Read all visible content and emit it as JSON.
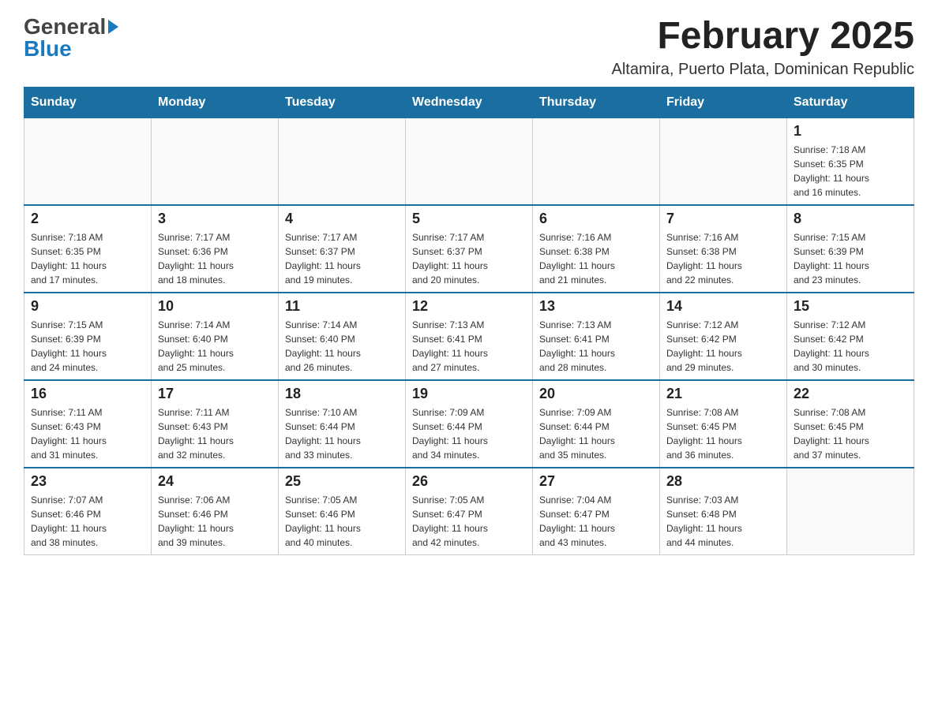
{
  "header": {
    "logo_general": "General",
    "logo_blue": "Blue",
    "month_title": "February 2025",
    "location": "Altamira, Puerto Plata, Dominican Republic"
  },
  "weekdays": [
    "Sunday",
    "Monday",
    "Tuesday",
    "Wednesday",
    "Thursday",
    "Friday",
    "Saturday"
  ],
  "weeks": [
    {
      "days": [
        {
          "number": "",
          "info": ""
        },
        {
          "number": "",
          "info": ""
        },
        {
          "number": "",
          "info": ""
        },
        {
          "number": "",
          "info": ""
        },
        {
          "number": "",
          "info": ""
        },
        {
          "number": "",
          "info": ""
        },
        {
          "number": "1",
          "info": "Sunrise: 7:18 AM\nSunset: 6:35 PM\nDaylight: 11 hours\nand 16 minutes."
        }
      ]
    },
    {
      "days": [
        {
          "number": "2",
          "info": "Sunrise: 7:18 AM\nSunset: 6:35 PM\nDaylight: 11 hours\nand 17 minutes."
        },
        {
          "number": "3",
          "info": "Sunrise: 7:17 AM\nSunset: 6:36 PM\nDaylight: 11 hours\nand 18 minutes."
        },
        {
          "number": "4",
          "info": "Sunrise: 7:17 AM\nSunset: 6:37 PM\nDaylight: 11 hours\nand 19 minutes."
        },
        {
          "number": "5",
          "info": "Sunrise: 7:17 AM\nSunset: 6:37 PM\nDaylight: 11 hours\nand 20 minutes."
        },
        {
          "number": "6",
          "info": "Sunrise: 7:16 AM\nSunset: 6:38 PM\nDaylight: 11 hours\nand 21 minutes."
        },
        {
          "number": "7",
          "info": "Sunrise: 7:16 AM\nSunset: 6:38 PM\nDaylight: 11 hours\nand 22 minutes."
        },
        {
          "number": "8",
          "info": "Sunrise: 7:15 AM\nSunset: 6:39 PM\nDaylight: 11 hours\nand 23 minutes."
        }
      ]
    },
    {
      "days": [
        {
          "number": "9",
          "info": "Sunrise: 7:15 AM\nSunset: 6:39 PM\nDaylight: 11 hours\nand 24 minutes."
        },
        {
          "number": "10",
          "info": "Sunrise: 7:14 AM\nSunset: 6:40 PM\nDaylight: 11 hours\nand 25 minutes."
        },
        {
          "number": "11",
          "info": "Sunrise: 7:14 AM\nSunset: 6:40 PM\nDaylight: 11 hours\nand 26 minutes."
        },
        {
          "number": "12",
          "info": "Sunrise: 7:13 AM\nSunset: 6:41 PM\nDaylight: 11 hours\nand 27 minutes."
        },
        {
          "number": "13",
          "info": "Sunrise: 7:13 AM\nSunset: 6:41 PM\nDaylight: 11 hours\nand 28 minutes."
        },
        {
          "number": "14",
          "info": "Sunrise: 7:12 AM\nSunset: 6:42 PM\nDaylight: 11 hours\nand 29 minutes."
        },
        {
          "number": "15",
          "info": "Sunrise: 7:12 AM\nSunset: 6:42 PM\nDaylight: 11 hours\nand 30 minutes."
        }
      ]
    },
    {
      "days": [
        {
          "number": "16",
          "info": "Sunrise: 7:11 AM\nSunset: 6:43 PM\nDaylight: 11 hours\nand 31 minutes."
        },
        {
          "number": "17",
          "info": "Sunrise: 7:11 AM\nSunset: 6:43 PM\nDaylight: 11 hours\nand 32 minutes."
        },
        {
          "number": "18",
          "info": "Sunrise: 7:10 AM\nSunset: 6:44 PM\nDaylight: 11 hours\nand 33 minutes."
        },
        {
          "number": "19",
          "info": "Sunrise: 7:09 AM\nSunset: 6:44 PM\nDaylight: 11 hours\nand 34 minutes."
        },
        {
          "number": "20",
          "info": "Sunrise: 7:09 AM\nSunset: 6:44 PM\nDaylight: 11 hours\nand 35 minutes."
        },
        {
          "number": "21",
          "info": "Sunrise: 7:08 AM\nSunset: 6:45 PM\nDaylight: 11 hours\nand 36 minutes."
        },
        {
          "number": "22",
          "info": "Sunrise: 7:08 AM\nSunset: 6:45 PM\nDaylight: 11 hours\nand 37 minutes."
        }
      ]
    },
    {
      "days": [
        {
          "number": "23",
          "info": "Sunrise: 7:07 AM\nSunset: 6:46 PM\nDaylight: 11 hours\nand 38 minutes."
        },
        {
          "number": "24",
          "info": "Sunrise: 7:06 AM\nSunset: 6:46 PM\nDaylight: 11 hours\nand 39 minutes."
        },
        {
          "number": "25",
          "info": "Sunrise: 7:05 AM\nSunset: 6:46 PM\nDaylight: 11 hours\nand 40 minutes."
        },
        {
          "number": "26",
          "info": "Sunrise: 7:05 AM\nSunset: 6:47 PM\nDaylight: 11 hours\nand 42 minutes."
        },
        {
          "number": "27",
          "info": "Sunrise: 7:04 AM\nSunset: 6:47 PM\nDaylight: 11 hours\nand 43 minutes."
        },
        {
          "number": "28",
          "info": "Sunrise: 7:03 AM\nSunset: 6:48 PM\nDaylight: 11 hours\nand 44 minutes."
        },
        {
          "number": "",
          "info": ""
        }
      ]
    }
  ]
}
